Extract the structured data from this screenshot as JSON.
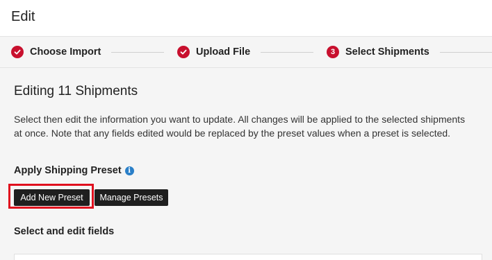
{
  "header": {
    "title": "Edit"
  },
  "stepper": {
    "steps": [
      {
        "label": "Choose Import",
        "status": "complete",
        "icon": "check-icon"
      },
      {
        "label": "Upload File",
        "status": "complete",
        "icon": "check-icon"
      },
      {
        "label": "Select Shipments",
        "status": "current",
        "number": "3"
      }
    ],
    "accent_color": "#c8102e"
  },
  "main": {
    "heading": "Editing 11 Shipments",
    "description": "Select then edit the information you want to update. All changes will be applied to the selected shipments at once. Note that any fields edited would be replaced by the preset values when a preset is selected.",
    "preset_label": "Apply Shipping Preset",
    "info_icon": "i",
    "buttons": {
      "add_new_preset": "Add New Preset",
      "manage_presets": "Manage Presets"
    },
    "edit_fields_label": "Select and edit fields"
  },
  "highlight_color": "#e0101e"
}
